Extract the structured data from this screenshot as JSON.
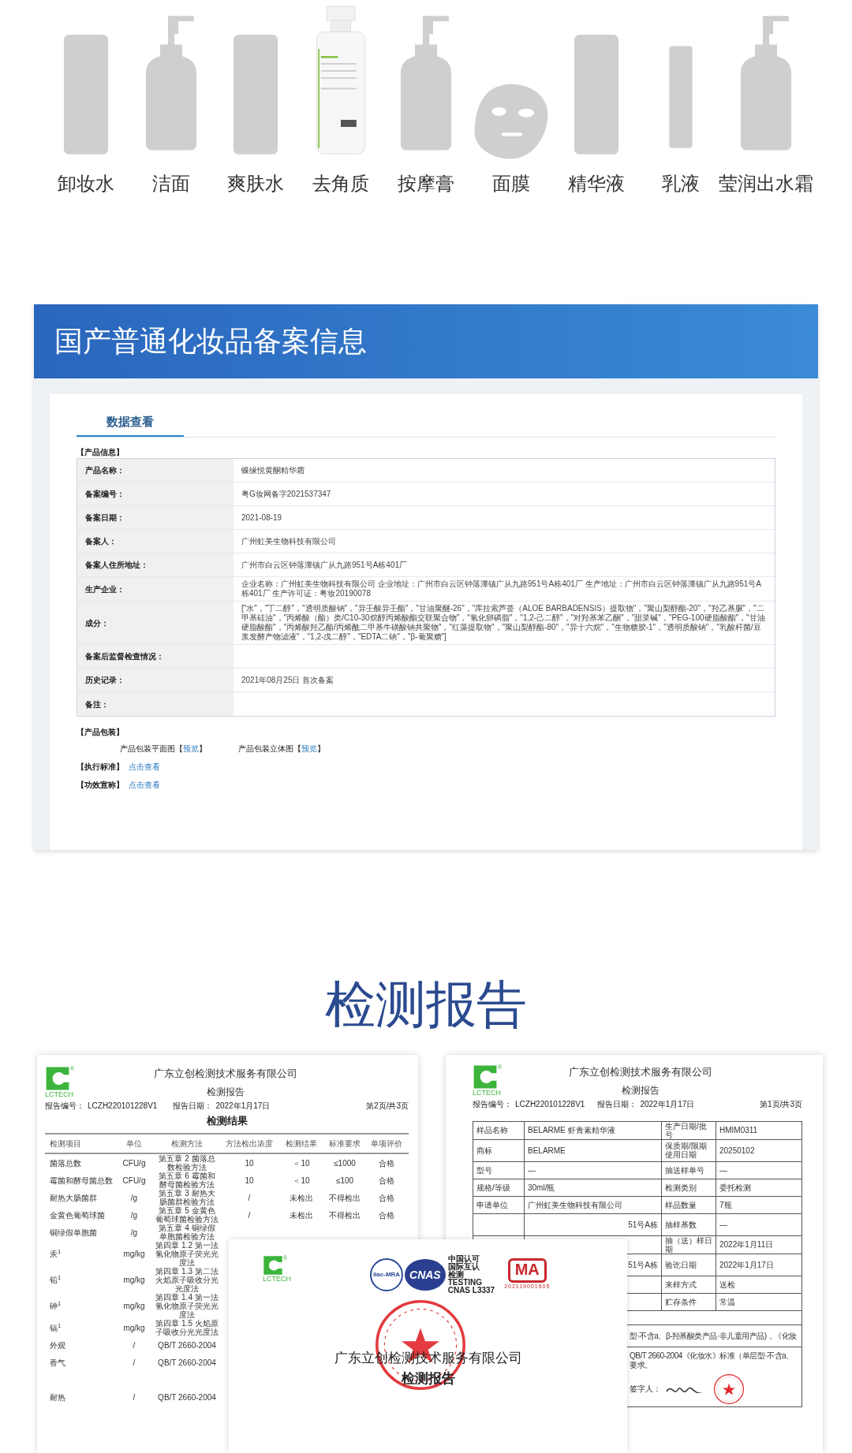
{
  "products": [
    {
      "label": "卸妆水",
      "kind": "bottle"
    },
    {
      "label": "洁面",
      "kind": "pump"
    },
    {
      "label": "爽肤水",
      "kind": "bottle"
    },
    {
      "label": "去角质"
    },
    {
      "label": "按摩膏",
      "kind": "pump"
    },
    {
      "label": "面膜",
      "kind": "mask"
    },
    {
      "label": "精华液",
      "kind": "bottle"
    },
    {
      "label": "乳液",
      "kind": "slim"
    },
    {
      "label": "莹润出水霜",
      "kind": "pump"
    }
  ],
  "registration": {
    "title": "国产普通化妆品备案信息",
    "tabs": [
      {
        "label": "数据查看",
        "selected": true
      }
    ],
    "info_heading": "【产品信息】",
    "rows": [
      {
        "label": "产品名称：",
        "value": "蝶缘悦黄酮精华霜"
      },
      {
        "label": "备案编号：",
        "value": "粤G妆网备字2021537347"
      },
      {
        "label": "备案日期：",
        "value": "2021-08-19"
      },
      {
        "label": "备案人：",
        "value": "广州虹美生物科技有限公司"
      },
      {
        "label": "备案人住所地址：",
        "value": "广州市白云区钟落潭镇广从九路951号A栋401厂"
      },
      {
        "label": "生产企业：",
        "value": "企业名称：广州虹美生物科技有限公司 企业地址：广州市白云区钟落潭镇广从九路951号A栋401厂 生产地址：广州市白云区钟落潭镇广从九路951号A栋401厂 生产许可证：粤妆20190078"
      },
      {
        "label": "成分：",
        "value": "[\"水\"，\"丁二醇\"，\"透明质酸钠\"，\"异壬酸异壬酯\"，\"甘油聚醚-26\"，\"库拉索芦荟（ALOE BARBADENSIS）提取物\"，\"聚山梨醇酯-20\"，\"羟乙基脲\"，\"二甲基硅油\"，\"丙烯酸（酯）类/C10-30烷醇丙烯酸酯交联聚合物\"，\"氢化卵磷脂\"，\"1,2-己二醇\"，\"对羟基苯乙酮\"，\"甜菜碱\"，\"PEG-100硬脂酸酯\"，\"甘油硬脂酸酯\"，\"丙烯酸羟乙酯/丙烯酰二甲基牛磺酸钠共聚物\"，\"红藻提取物\"，\"聚山梨醇酯-80\"，\"异十六烷\"，\"生物糖胶-1\"，\"透明质酸钠\"，\"乳酸杆菌/豆浆发酵产物滤液\"，\"1,2-戊二醇\"，\"EDTA二钠\"，\"β-葡聚糖\"]"
      },
      {
        "label": "备案后监督检查情况："
      },
      {
        "label": "历史记录：",
        "value": "2021年08月25日 首次备案"
      },
      {
        "label": "备注："
      }
    ],
    "packaging_heading": "【产品包装】",
    "packaging": [
      {
        "label": "产品包装平面图",
        "open": "【",
        "link": "预览",
        "close": "】"
      },
      {
        "label": "产品包装立体图",
        "open": "【",
        "link": "预览",
        "close": "】"
      }
    ],
    "links": [
      {
        "label": "【执行标准】",
        "link": "点击查看"
      },
      {
        "label": "【功效宣称】",
        "link": "点击查看"
      }
    ]
  },
  "report_title": "检测报告",
  "results_doc": {
    "logo_text": "LCTECH",
    "logo_mark": "®",
    "company": "广东立创检测技术服务有限公司",
    "doc_title": "检测报告",
    "number_label": "报告编号：",
    "number": "LCZH220101228V1",
    "date_label": "报告日期：",
    "date": "2022年1月17日",
    "page": "第2页/共3页",
    "table_title": "检测结果",
    "columns": [
      "检测项目",
      "单位",
      "检测方法",
      "方法检出浓度",
      "检测结果",
      "标准要求",
      "单项评价"
    ],
    "rows": [
      [
        "菌落总数",
        "CFU/g",
        "第五章 2 菌落总数检验方法",
        "10",
        "＜10",
        "≤1000",
        "合格"
      ],
      [
        "霉菌和酵母菌总数",
        "CFU/g",
        "第五章 6 霉菌和酵母菌检验方法",
        "10",
        "＜10",
        "≤100",
        "合格"
      ],
      [
        "耐热大肠菌群",
        "/g",
        "第五章 3 耐热大肠菌群检验方法",
        "/",
        "未检出",
        "不得检出",
        "合格"
      ],
      [
        "金黄色葡萄球菌",
        "/g",
        "第五章 5 金黄色葡萄球菌检验方法",
        "/",
        "未检出",
        "不得检出",
        "合格"
      ],
      [
        "铜绿假单胞菌",
        "/g",
        "第五章 4 铜绿假单胞菌检验方法"
      ],
      [
        "汞$^{1}$",
        "mg/kg",
        "第四章 1.2 第一法氢化物原子荧光光度法"
      ],
      [
        "铅$^{1}$",
        "mg/kg",
        "第四章 1.3 第二法火焰原子吸收分光光度法"
      ],
      [
        "砷$^{1}$",
        "mg/kg",
        "第四章 1.4 第一法氢化物原子荧光光度法"
      ],
      [
        "镉$^{1}$",
        "mg/kg",
        "第四章 1.5 火焰原子吸收分光光度法"
      ],
      [
        "外观",
        "/",
        "QB/T 2660-2004"
      ],
      [
        "香气",
        "/",
        "QB/T 2660-2004"
      ],
      [
        "耐热",
        "/",
        "QB/T 2660-2004"
      ]
    ]
  },
  "info_doc": {
    "logo_text": "LCTECH",
    "logo_mark": "®",
    "company": "广东立创检测技术服务有限公司",
    "doc_title": "检测报告",
    "number_label": "报告编号：",
    "number": "LCZH220101228V1",
    "date_label": "报告日期：",
    "date": "2022年1月17日",
    "page": "第1页/共3页",
    "rows": [
      [
        "样品名称",
        "BELARME 虾青素精华液",
        "生产日期/批号",
        "HMIM0311"
      ],
      [
        "商标",
        "BELARME",
        "保质期/限期使用日期",
        "20250102"
      ],
      [
        "型号",
        "—",
        "抽送样单号",
        "—"
      ],
      [
        "规格/等级",
        "30ml/瓶",
        "检测类别",
        "委托检测"
      ],
      [
        "申请单位",
        "广州虹美生物科技有限公司",
        "样品数量",
        "7瓶"
      ],
      [
        "51号A栋",
        "抽样基数",
        "—"
      ],
      [
        "",
        "抽（送）样日期",
        "2022年1月11日"
      ],
      [
        "51号A栋",
        "验讫日期",
        "2022年1月17日"
      ],
      [
        "",
        "来样方式",
        "送检"
      ],
      [
        "",
        "贮存条件",
        "常温"
      ]
    ],
    "notes": [
      "型·不含a、β-羟基酸类产品·非儿童用产品)，《化妆",
      "QB/T 2660-2004《化妆水》标准（单层型·不含a、",
      "要求。"
    ],
    "signer_label": "签字人："
  },
  "cover_doc": {
    "logo_text": "LCTECH",
    "logo_mark": "®",
    "cnas_lines": [
      "中国认可",
      "国际互认",
      "检测",
      "TESTING",
      "CNAS L3337"
    ],
    "ilac": "ilac-MRA",
    "cnas": "CNAS",
    "cma": "MA",
    "cma_number": "202119001605",
    "company": "广东立创检测技术服务有限公司",
    "doc_title": "检测报告"
  }
}
